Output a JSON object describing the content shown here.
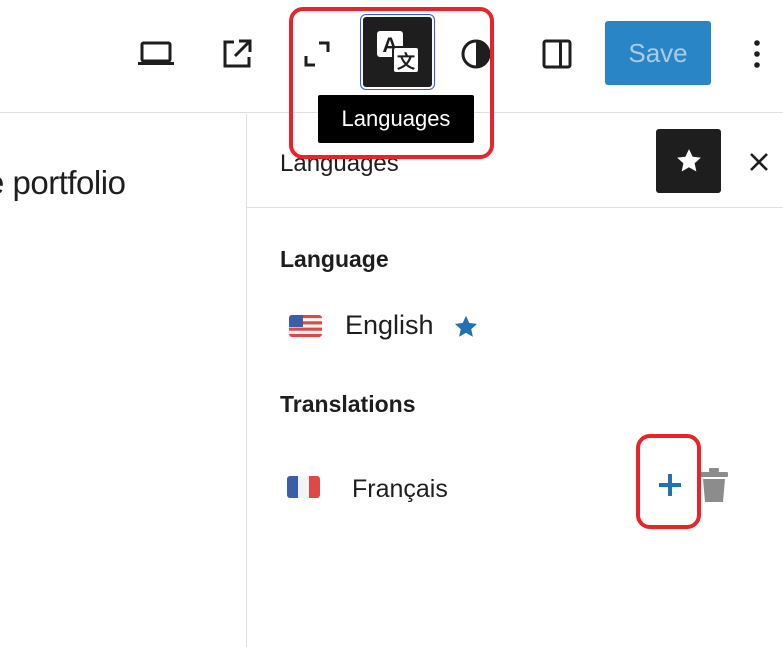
{
  "toolbar": {
    "desktop_icon": "desktop-preview-icon",
    "view_icon": "external-view-icon",
    "fullscreen_icon": "fullscreen-icon",
    "languages_icon": "translate-icon",
    "styles_icon": "half-circle-contrast-icon",
    "sidebar_icon": "sidebar-toggle-icon",
    "save_label": "Save",
    "more_icon": "vertical-ellipsis-icon"
  },
  "tooltip": {
    "text": "Languages"
  },
  "canvas": {
    "text": "e portfolio"
  },
  "sidebar": {
    "title": "Languages",
    "language_label": "Language",
    "translations_label": "Translations",
    "language": {
      "name": "English",
      "flag": "us-flag-icon",
      "is_default": true
    },
    "translations": [
      {
        "name": "Français",
        "flag": "fr-flag-icon"
      }
    ]
  },
  "colors": {
    "save_bg": "#2a85c6",
    "accent_blue": "#2271b1",
    "highlight_red": "#e8232a",
    "dark_button": "#1e1e1e"
  }
}
